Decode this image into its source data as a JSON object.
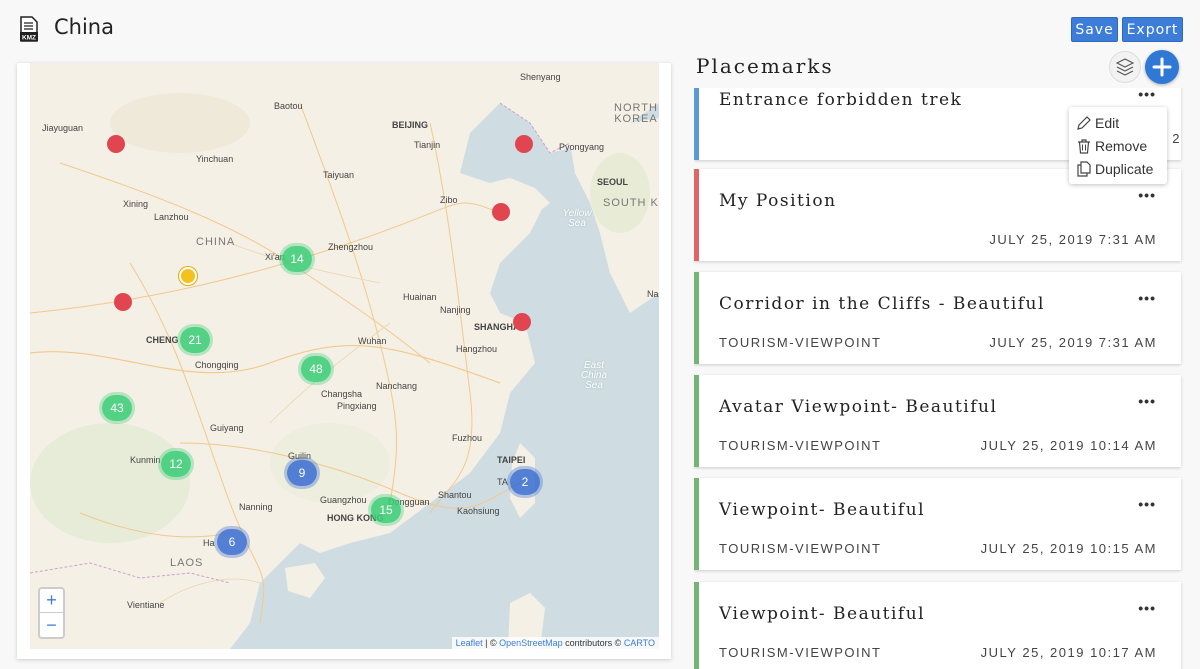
{
  "app": {
    "title": "China",
    "file_badge": "KMZ",
    "save_label": "Save",
    "export_label": "Export"
  },
  "map": {
    "countries": [
      {
        "label": "NORTH KOREA",
        "lines": [
          "NORTH",
          "KOREA"
        ]
      },
      {
        "label": "SOUTH KO"
      },
      {
        "label": "CHINA"
      },
      {
        "label": "LAOS"
      }
    ],
    "seas": [
      "Yellow Sea",
      "East China Sea"
    ],
    "cities": [
      "Shenyang",
      "Baotou",
      "Jiayuguan",
      "BEIJING",
      "Tianjin",
      "Pyongyang",
      "Yinchuan",
      "Taiyuan",
      "SEOUL",
      "Xining",
      "Zibo",
      "Lanzhou",
      "Zhengzhou",
      "Xi'an",
      "Huainan",
      "Nanjing",
      "Na",
      "SHANGHAI",
      "CHENG",
      "Wuhan",
      "Hangzhou",
      "Chongqing",
      "Nanchang",
      "Changsha",
      "Pingxiang",
      "Guiyang",
      "Fuzhou",
      "Kunmin",
      "Guilin",
      "TAIPEI",
      "TA",
      "Shantou",
      "Kaohsiung",
      "Nanning",
      "Guangzhou",
      "Dongguan",
      "HONG KONG",
      "Ha",
      "Vientiane"
    ],
    "clusters": [
      {
        "count": "14",
        "color": "green"
      },
      {
        "count": "21",
        "color": "green"
      },
      {
        "count": "48",
        "color": "green"
      },
      {
        "count": "43",
        "color": "green"
      },
      {
        "count": "12",
        "color": "green"
      },
      {
        "count": "9",
        "color": "blue"
      },
      {
        "count": "2",
        "color": "blue"
      },
      {
        "count": "15",
        "color": "green"
      },
      {
        "count": "6",
        "color": "blue"
      }
    ],
    "zoom_in": "+",
    "zoom_out": "−",
    "attribution": {
      "leaflet": "Leaflet",
      "sep1": " | © ",
      "osm": "OpenStreetMap",
      "mid": " contributors © ",
      "carto": "CARTO"
    }
  },
  "placemarks": {
    "title": "Placemarks",
    "items": [
      {
        "name": "Entrance forbidden trek",
        "tag": "",
        "date": "JULY 24, 2",
        "color": "#5b9bd5"
      },
      {
        "name": "My Position",
        "tag": "",
        "date": "JULY 25, 2019 7:31 AM",
        "color": "#e06666"
      },
      {
        "name": "Corridor in the Cliffs - Beautiful",
        "tag": "TOURISM-VIEWPOINT",
        "date": "JULY 25, 2019 7:31 AM",
        "color": "#74b474"
      },
      {
        "name": "Avatar Viewpoint- Beautiful",
        "tag": "TOURISM-VIEWPOINT",
        "date": "JULY 25, 2019 10:14 AM",
        "color": "#74b474"
      },
      {
        "name": "Viewpoint- Beautiful",
        "tag": "TOURISM-VIEWPOINT",
        "date": "JULY 25, 2019 10:15 AM",
        "color": "#74b474"
      },
      {
        "name": "Viewpoint- Beautiful",
        "tag": "TOURISM-VIEWPOINT",
        "date": "JULY 25, 2019 10:17 AM",
        "color": "#74b474"
      }
    ],
    "more_label": "•••",
    "menu": {
      "edit": "Edit",
      "remove": "Remove",
      "duplicate": "Duplicate"
    }
  }
}
